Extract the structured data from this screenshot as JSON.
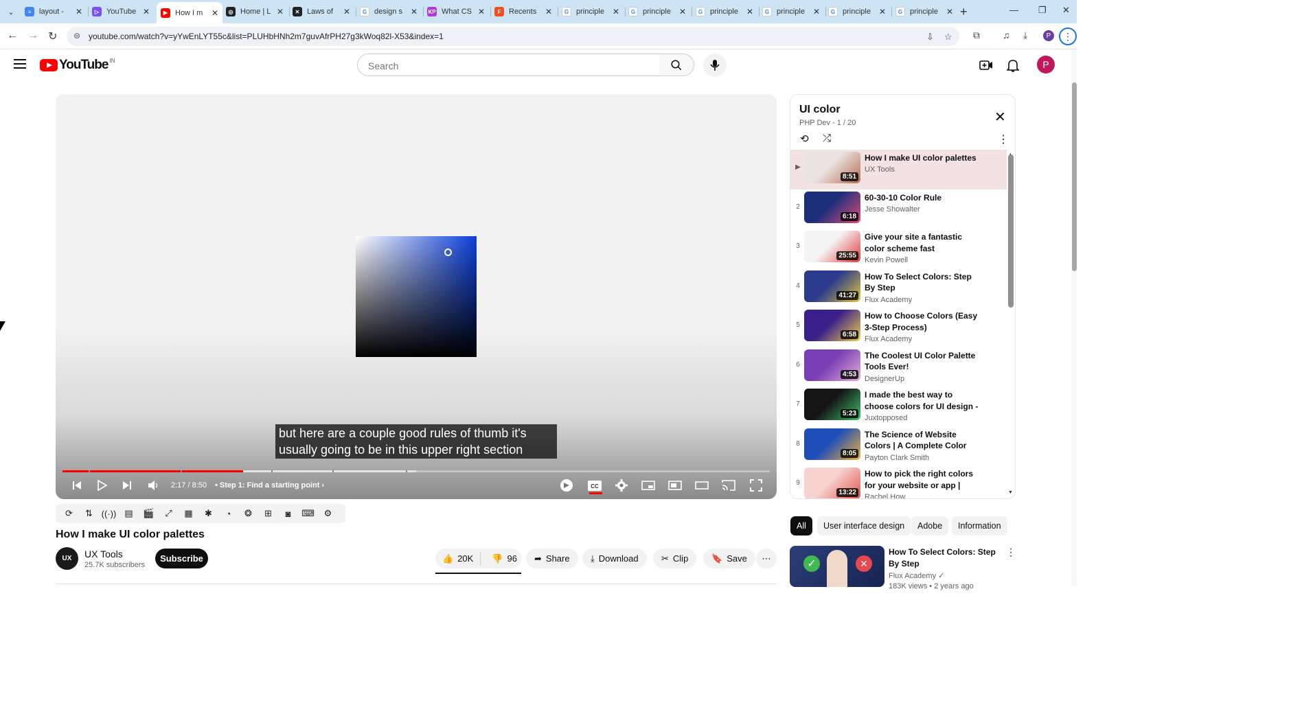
{
  "browser": {
    "tabs": [
      {
        "title": "layout - ",
        "color": "#4285f4",
        "glyph": "≡"
      },
      {
        "title": "YouTube",
        "color": "#7b4ff0",
        "glyph": "▷"
      },
      {
        "title": "How I m",
        "color": "#ff0000",
        "glyph": "▶"
      },
      {
        "title": "Home | L",
        "color": "#222222",
        "glyph": "◎"
      },
      {
        "title": "Laws of",
        "color": "#222222",
        "glyph": "✕"
      },
      {
        "title": "design s",
        "color": "#ffffff",
        "glyph": "G"
      },
      {
        "title": "What CS",
        "color": "#b03ad8",
        "glyph": "KP"
      },
      {
        "title": "Recents",
        "color": "#f24e1e",
        "glyph": "F"
      },
      {
        "title": "principle",
        "color": "#ffffff",
        "glyph": "G"
      },
      {
        "title": "principle",
        "color": "#ffffff",
        "glyph": "G"
      },
      {
        "title": "principle",
        "color": "#ffffff",
        "glyph": "G"
      },
      {
        "title": "principle",
        "color": "#ffffff",
        "glyph": "G"
      },
      {
        "title": "principle",
        "color": "#ffffff",
        "glyph": "G"
      },
      {
        "title": "principle",
        "color": "#ffffff",
        "glyph": "G"
      }
    ],
    "url": "youtube.com/watch?v=yYwEnLYT55c&list=PLUHbHNh2m7guvAfrPH27g3kWoq82l-X53&index=1",
    "profile_initial": "P"
  },
  "header": {
    "logo_text": "YouTube",
    "country_code": "IN",
    "search_placeholder": "Search",
    "avatar_initial": "P"
  },
  "player": {
    "caption_line1": "but here are a couple good rules of thumb it's",
    "caption_line2": "usually going to be in this upper right section",
    "time": "2:17 / 8:50",
    "chapter": "• Step 1: Find a starting point",
    "played_fraction": 0.255,
    "loaded_fraction": 0.5
  },
  "video": {
    "title": "How I make UI color palettes",
    "channel": "UX Tools",
    "channel_avatar_text": "UX",
    "subscribers": "25.7K subscribers",
    "subscribe_label": "Subscribe",
    "likes": "20K",
    "dislikes": "96",
    "share_label": "Share",
    "download_label": "Download",
    "clip_label": "Clip",
    "save_label": "Save"
  },
  "playlist": {
    "title": "UI color",
    "meta": "PHP Dev - 1 / 20",
    "items": [
      {
        "index": "▶",
        "title": "How I make UI color palettes",
        "channel": "UX Tools",
        "duration": "8:51",
        "thumb_colors": [
          "#e9e4df",
          "#b86a52"
        ]
      },
      {
        "index": "2",
        "title": "60-30-10 Color Rule",
        "channel": "Jesse Showalter",
        "duration": "6:18",
        "thumb_colors": [
          "#1c2f7a",
          "#e34b7b"
        ]
      },
      {
        "index": "3",
        "title": "Give your site a fantastic color scheme fast",
        "channel": "Kevin Powell",
        "duration": "25:55",
        "thumb_colors": [
          "#f4f4f4",
          "#e23a3a"
        ]
      },
      {
        "index": "4",
        "title": "How To Select Colors: Step By Step",
        "channel": "Flux Academy",
        "duration": "41:27",
        "thumb_colors": [
          "#2a3b8c",
          "#e9c93a"
        ]
      },
      {
        "index": "5",
        "title": "How to Choose Colors (Easy 3-Step Process)",
        "channel": "Flux Academy",
        "duration": "6:58",
        "thumb_colors": [
          "#3b1f8a",
          "#f3d34a"
        ]
      },
      {
        "index": "6",
        "title": "The Coolest UI Color Palette Tools Ever!",
        "channel": "DesignerUp",
        "duration": "4:53",
        "thumb_colors": [
          "#7a3fb5",
          "#e7b0d8"
        ]
      },
      {
        "index": "7",
        "title": "I made the best way to choose colors for UI design - Realtim...",
        "channel": "Juxtopposed",
        "duration": "5:23",
        "thumb_colors": [
          "#141414",
          "#3fc26a"
        ]
      },
      {
        "index": "8",
        "title": "The Science of Website Colors | A Complete Color Guide",
        "channel": "Payton Clark Smith",
        "duration": "8:05",
        "thumb_colors": [
          "#1e4fb8",
          "#f5b23a"
        ]
      },
      {
        "index": "9",
        "title": "How to pick the right colors for your website or app | UI/UX...",
        "channel": "Rachel How",
        "duration": "13:22",
        "thumb_colors": [
          "#f7d2cf",
          "#e0574a"
        ]
      }
    ]
  },
  "chips": [
    "All",
    "User interface design",
    "Adobe",
    "Information"
  ],
  "recommendation": {
    "title": "How To Select Colors: Step By Step",
    "channel": "Flux Academy ✓",
    "views": "183K views • 2 years ago"
  }
}
